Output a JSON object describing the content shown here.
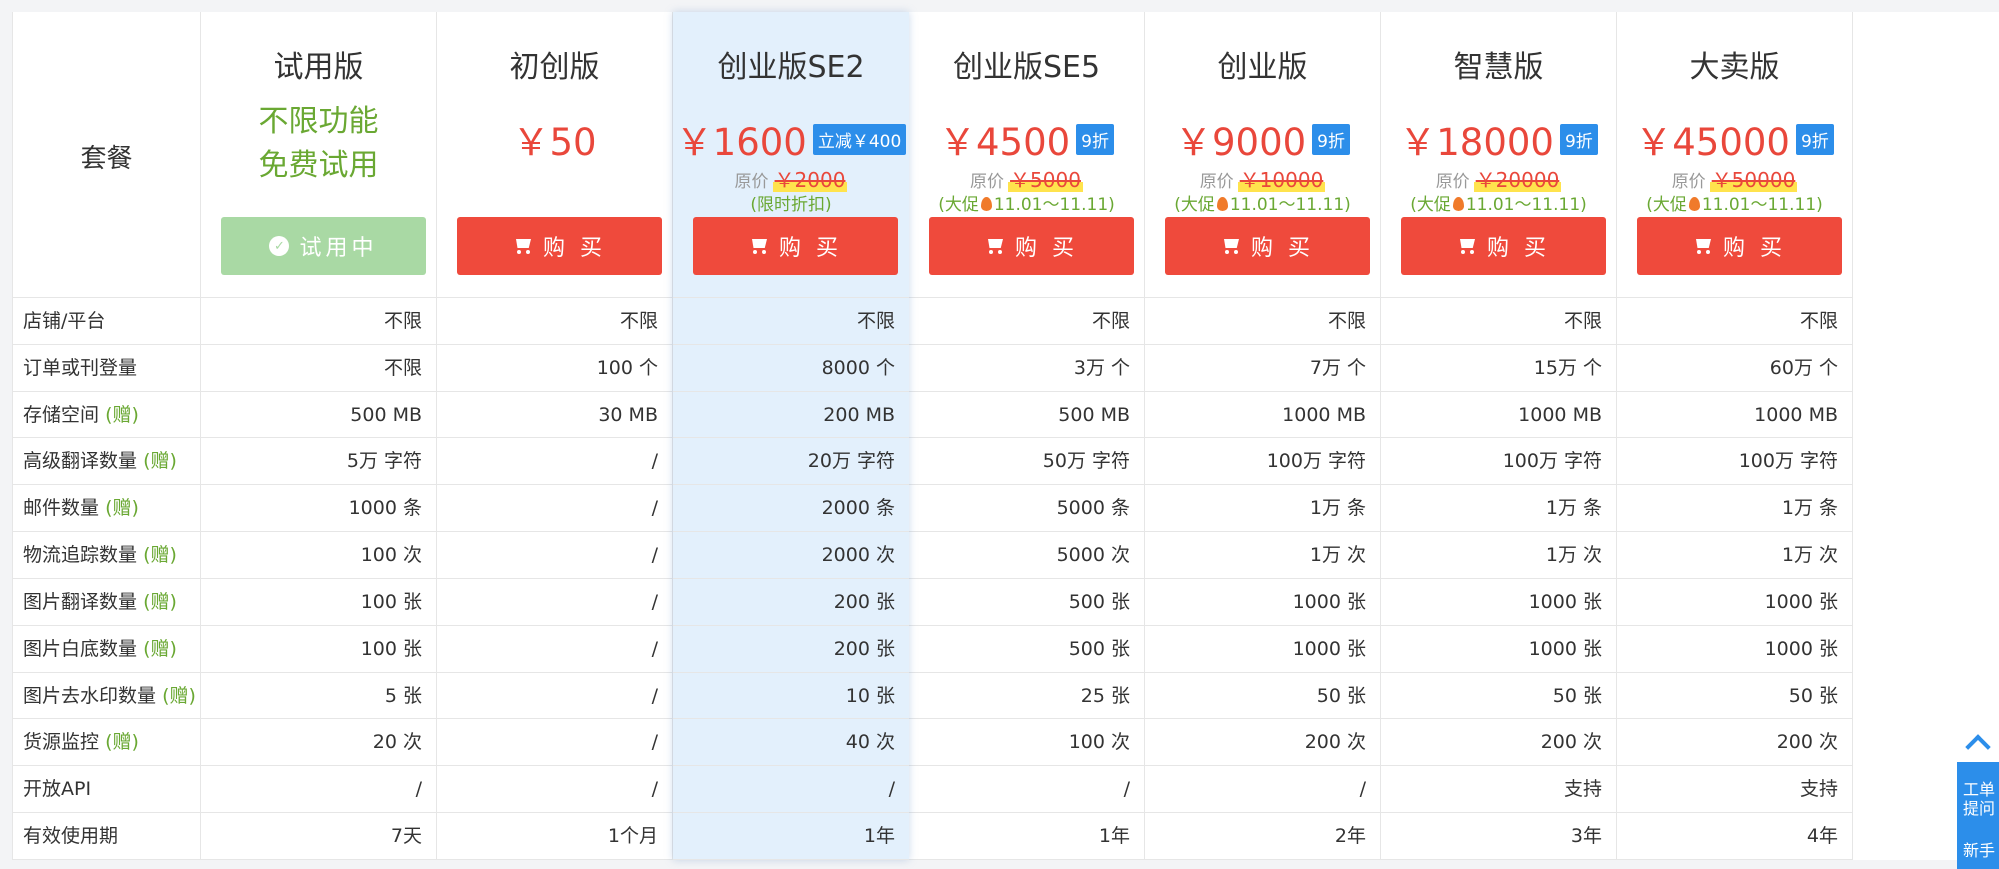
{
  "label_header": "套餐",
  "rows": [
    {
      "label": "店铺/平台",
      "gift": ""
    },
    {
      "label": "订单或刊登量",
      "gift": ""
    },
    {
      "label": "存储空间",
      "gift": "(赠)"
    },
    {
      "label": "高级翻译数量",
      "gift": "(赠)"
    },
    {
      "label": "邮件数量",
      "gift": "(赠)"
    },
    {
      "label": "物流追踪数量",
      "gift": "(赠)"
    },
    {
      "label": "图片翻译数量",
      "gift": "(赠)"
    },
    {
      "label": "图片白底数量",
      "gift": "(赠)"
    },
    {
      "label": "图片去水印数量",
      "gift": "(赠)"
    },
    {
      "label": "货源监控",
      "gift": "(赠)"
    },
    {
      "label": "开放API",
      "gift": ""
    },
    {
      "label": "有效使用期",
      "gift": ""
    }
  ],
  "plans": [
    {
      "name": "试用版",
      "trial_lines": [
        "不限功能",
        "免费试用"
      ],
      "button": "试用中",
      "button_type": "trial",
      "values": [
        "不限",
        "不限",
        "500 MB",
        "5万 字符",
        "1000 条",
        "100 次",
        "100 张",
        "100 张",
        "5 张",
        "20 次",
        "/",
        "7天"
      ]
    },
    {
      "name": "初创版",
      "price": "￥50",
      "button": "购 买",
      "button_type": "buy",
      "values": [
        "不限",
        "100 个",
        "30 MB",
        "/",
        "/",
        "/",
        "/",
        "/",
        "/",
        "/",
        "/",
        "1个月"
      ]
    },
    {
      "name": "创业版SE2",
      "price": "￥1600",
      "badge": "立减￥400",
      "orig_label": "原价",
      "orig_price": "￥2000",
      "promo": "(限时折扣)",
      "highlight": true,
      "button": "购 买",
      "button_type": "buy",
      "values": [
        "不限",
        "8000 个",
        "200 MB",
        "20万 字符",
        "2000 条",
        "2000 次",
        "200 张",
        "200 张",
        "10 张",
        "40 次",
        "/",
        "1年"
      ]
    },
    {
      "name": "创业版SE5",
      "price": "￥4500",
      "badge": "9折",
      "orig_label": "原价",
      "orig_price": "￥5000",
      "promo_pre": "(大促",
      "promo_post": "11.01～11.11)",
      "button": "购 买",
      "button_type": "buy",
      "values": [
        "不限",
        "3万 个",
        "500 MB",
        "50万 字符",
        "5000 条",
        "5000 次",
        "500 张",
        "500 张",
        "25 张",
        "100 次",
        "/",
        "1年"
      ]
    },
    {
      "name": "创业版",
      "price": "￥9000",
      "badge": "9折",
      "orig_label": "原价",
      "orig_price": "￥10000",
      "promo_pre": "(大促",
      "promo_post": "11.01～11.11)",
      "button": "购 买",
      "button_type": "buy",
      "values": [
        "不限",
        "7万 个",
        "1000 MB",
        "100万 字符",
        "1万 条",
        "1万 次",
        "1000 张",
        "1000 张",
        "50 张",
        "200 次",
        "/",
        "2年"
      ]
    },
    {
      "name": "智慧版",
      "price": "￥18000",
      "badge": "9折",
      "orig_label": "原价",
      "orig_price": "￥20000",
      "promo_pre": "(大促",
      "promo_post": "11.01～11.11)",
      "button": "购 买",
      "button_type": "buy",
      "values": [
        "不限",
        "15万 个",
        "1000 MB",
        "100万 字符",
        "1万 条",
        "1万 次",
        "1000 张",
        "1000 张",
        "50 张",
        "200 次",
        "支持",
        "3年"
      ]
    },
    {
      "name": "大卖版",
      "price": "￥45000",
      "badge": "9折",
      "orig_label": "原价",
      "orig_price": "￥50000",
      "promo_pre": "(大促",
      "promo_post": "11.01～11.11)",
      "button": "购 买",
      "button_type": "buy",
      "values": [
        "不限",
        "60万 个",
        "1000 MB",
        "100万 字符",
        "1万 条",
        "1万 次",
        "1000 张",
        "1000 张",
        "50 张",
        "200 次",
        "支持",
        "4年"
      ]
    }
  ],
  "side_widget": {
    "items": [
      "工单",
      "提问",
      "新手"
    ]
  },
  "colors": {
    "price_red": "#e9473b",
    "buy_button": "#ef4a3c",
    "trial_button": "#a9d9a4",
    "free_green": "#6aa833",
    "badge_blue": "#2c8eea",
    "highlight_bg": "#e3f0fc"
  }
}
